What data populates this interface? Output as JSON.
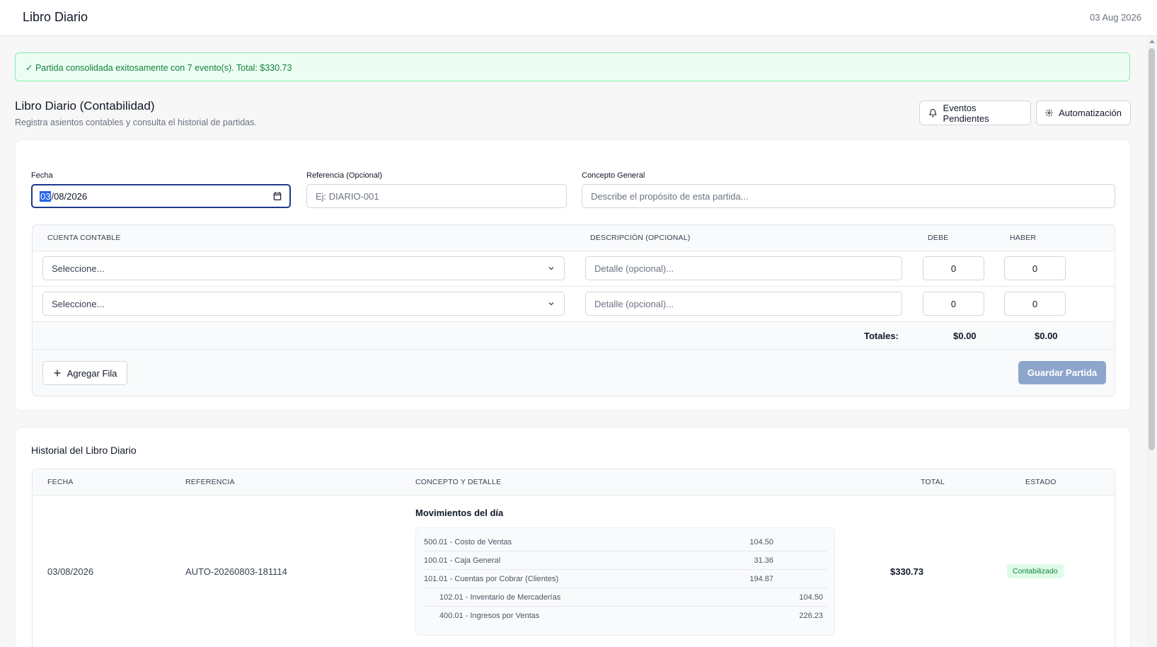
{
  "header": {
    "title": "Libro Diario",
    "date": "03 Aug 2026"
  },
  "alert": {
    "message": "✓ Partida consolidada exitosamente con 7 evento(s). Total: $330.73"
  },
  "page": {
    "title": "Libro Diario (Contabilidad)",
    "subtitle": "Registra asientos contables y consulta el historial de partidas.",
    "events_button": "Eventos Pendientes",
    "automation_button": "Automatización"
  },
  "form": {
    "date_label": "Fecha",
    "date_selected_part": "03",
    "date_rest": "/08/2026",
    "ref_label": "Referencia (Opcional)",
    "ref_placeholder": "Ej: DIARIO-001",
    "concept_label": "Concepto General",
    "concept_placeholder": "Describe el propósito de esta partida..."
  },
  "lines": {
    "headers": {
      "account": "CUENTA CONTABLE",
      "description": "DESCRIPCIÓN (OPCIONAL)",
      "debit": "DEBE",
      "credit": "HABER"
    },
    "rows": [
      {
        "account": "Seleccione...",
        "description": "Detalle (opcional)...",
        "debit": "0",
        "credit": "0"
      },
      {
        "account": "Seleccione...",
        "description": "Detalle (opcional)...",
        "debit": "0",
        "credit": "0"
      }
    ],
    "totals_label": "Totales:",
    "total_debit": "$0.00",
    "total_credit": "$0.00",
    "add_row_button": "Agregar Fila",
    "save_button": "Guardar Partida"
  },
  "history": {
    "title": "Historial del Libro Diario",
    "headers": {
      "date": "FECHA",
      "reference": "REFERENCIA",
      "concept": "CONCEPTO Y DETALLE",
      "total": "TOTAL",
      "status": "ESTADO"
    },
    "entries": [
      {
        "date": "03/08/2026",
        "reference": "AUTO-20260803-181114",
        "concept_title": "Movimientos del día",
        "details": [
          {
            "account": "500.01 - Costo de Ventas",
            "debit": "104.50",
            "credit": ""
          },
          {
            "account": "100.01 - Caja General",
            "debit": "31.36",
            "credit": ""
          },
          {
            "account": "101.01 - Cuentas por Cobrar (Clientes)",
            "debit": "194.87",
            "credit": ""
          },
          {
            "account": "102.01 - Inventario de Mercaderías",
            "debit": "",
            "credit": "104.50"
          },
          {
            "account": "400.01 - Ingresos por Ventas",
            "debit": "",
            "credit": "226.23"
          }
        ],
        "total": "$330.73",
        "status": "Contabilizado"
      }
    ]
  },
  "icons": {
    "events": "bell-icon",
    "automation": "gear-icon",
    "calendar": "calendar-icon",
    "chevron": "chevron-down-icon",
    "add": "plus-icon"
  }
}
